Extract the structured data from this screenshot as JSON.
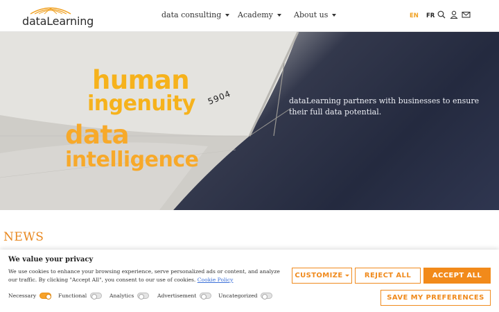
{
  "header": {
    "logo_text": "dataLearning",
    "nav": [
      {
        "label": "data consulting"
      },
      {
        "label": "Academy"
      },
      {
        "label": "About us"
      }
    ],
    "lang_en": "EN",
    "lang_fr": "FR",
    "icons": [
      "search-icon",
      "user-icon",
      "mail-icon"
    ]
  },
  "hero": {
    "line1": "human",
    "line2": "ingenuity",
    "line3": "data",
    "line4": "intelligence",
    "hull_text": "5904",
    "tagline": "dataLearning partners with businesses to ensure their full data potential."
  },
  "news": {
    "title": "NEWS"
  },
  "cookie": {
    "title": "We value your privacy",
    "text": "We use cookies to enhance your browsing experience, serve personalized ads or content, and analyze our traffic. By clicking \"Accept All\", you consent to our use of cookies.",
    "link": "Cookie Policy",
    "toggles": [
      {
        "label": "Necessary",
        "on": true
      },
      {
        "label": "Functional",
        "on": false
      },
      {
        "label": "Analytics",
        "on": false
      },
      {
        "label": "Advertisement",
        "on": false
      },
      {
        "label": "Uncategorized",
        "on": false
      }
    ],
    "customize_label": "CUSTOMIZE",
    "reject_label": "REJECT ALL",
    "accept_label": "ACCEPT ALL",
    "save_label": "SAVE MY PREFERENCES"
  },
  "colors": {
    "accent": "#f28a1a",
    "hero_text": "#f6b21c",
    "link": "#3a6fd8"
  }
}
